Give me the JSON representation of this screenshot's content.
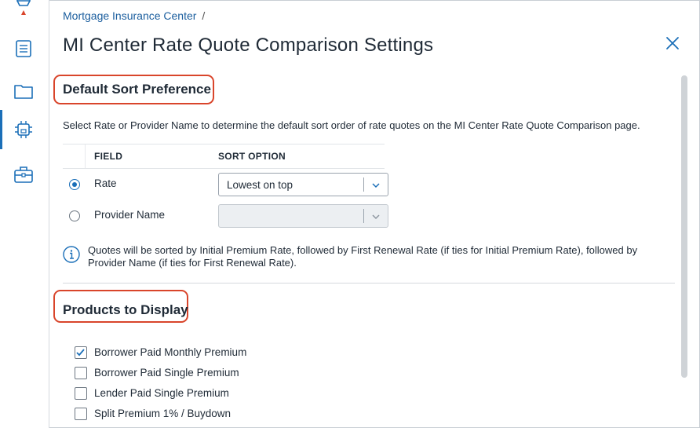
{
  "colors": {
    "accent": "#1b6fb8",
    "highlight": "#d9452b",
    "text": "#1f2a36",
    "link": "#1b5e9e"
  },
  "rail": {
    "icons": [
      "plug-icon",
      "list-icon",
      "folder-icon",
      "chip-icon",
      "briefcase-icon"
    ],
    "active": "chip-icon"
  },
  "header": {
    "breadcrumb": "Mortgage Insurance Center",
    "breadcrumb_sep": "/",
    "title": "MI Center Rate Quote Comparison Settings"
  },
  "sort": {
    "title": "Default Sort Preference",
    "description": "Select Rate or Provider Name to determine the default sort order of rate quotes on the MI Center Rate Quote Comparison page.",
    "columns": [
      "FIELD",
      "SORT OPTION"
    ],
    "rows": [
      {
        "field": "Rate",
        "selected": true,
        "sort_option": "Lowest on top",
        "disabled": false
      },
      {
        "field": "Provider Name",
        "selected": false,
        "sort_option": "",
        "disabled": true
      }
    ],
    "info": "Quotes will be sorted by Initial Premium Rate, followed by First Renewal Rate (if ties for Initial Premium Rate), followed by Provider Name (if ties for First Renewal Rate)."
  },
  "products": {
    "title": "Products to Display",
    "items": [
      {
        "label": "Borrower Paid Monthly Premium",
        "checked": true
      },
      {
        "label": "Borrower Paid Single Premium",
        "checked": false
      },
      {
        "label": "Lender Paid Single Premium",
        "checked": false
      },
      {
        "label": "Split Premium 1% / Buydown",
        "checked": false
      }
    ]
  }
}
